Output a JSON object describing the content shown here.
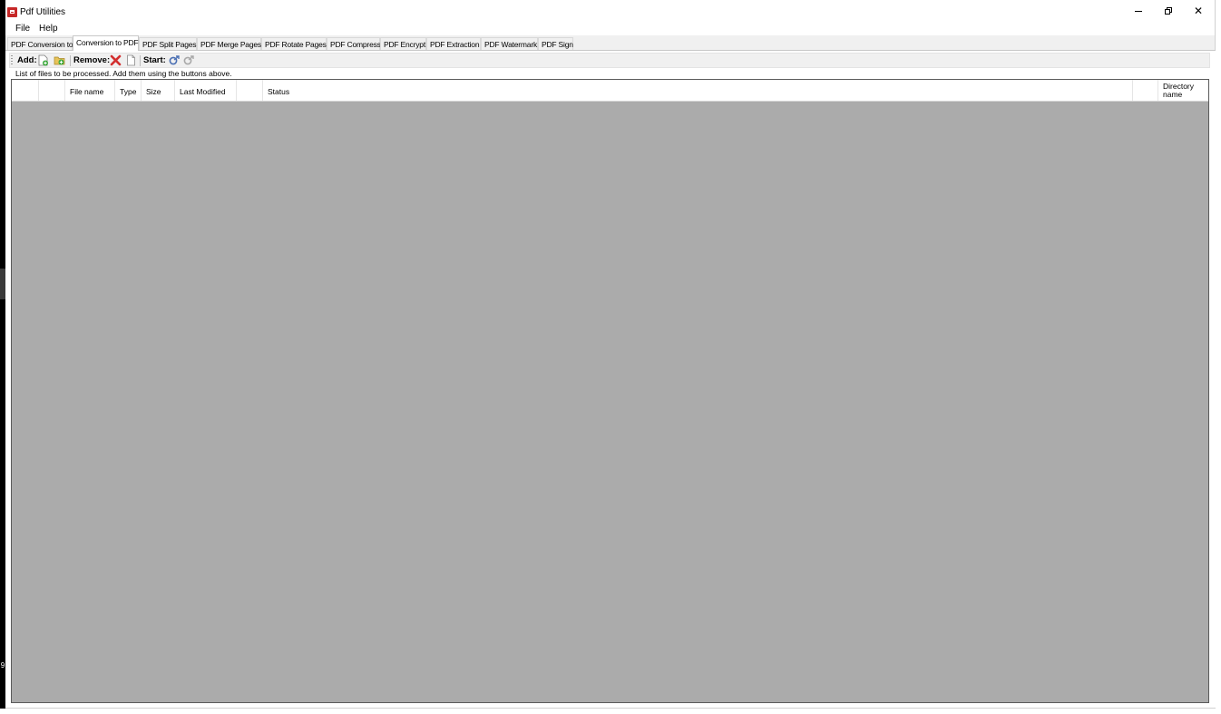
{
  "window": {
    "title": "Pdf Utilities",
    "controls": {
      "minimize": "–",
      "maximize": "❐",
      "close": "✕"
    }
  },
  "menu": [
    "File",
    "Help"
  ],
  "tabs": [
    "PDF Conversion to",
    "Conversion to PDF",
    "PDF Split Pages",
    "PDF Merge Pages",
    "PDF Rotate Pages",
    "PDF Compress",
    "PDF Encrypt",
    "PDF Extraction",
    "PDF Watermark",
    "PDF Sign"
  ],
  "active_tab": "Conversion to PDF",
  "toolbar": {
    "add_label": "Add:",
    "remove_label": "Remove:",
    "start_label": "Start:",
    "icons": {
      "add_file": "add-file-icon",
      "add_folder": "add-folder-icon",
      "remove_selected": "red-x-icon",
      "remove_all": "blank-page-icon",
      "start": "convert-icon",
      "start_disabled": "convert-disabled-icon"
    }
  },
  "hint": "List of files to be processed. Add  them using the buttons above.",
  "file_list": {
    "columns": [
      "",
      "",
      "File name",
      "Type",
      "Size",
      "Last Modified",
      "",
      "Status",
      "",
      "Directory name"
    ],
    "rows": []
  },
  "left_edge_digit": "9",
  "colors": {
    "app_icon": "#c62828",
    "list_background": "#ababab",
    "window_background": "#f0f0f0"
  }
}
